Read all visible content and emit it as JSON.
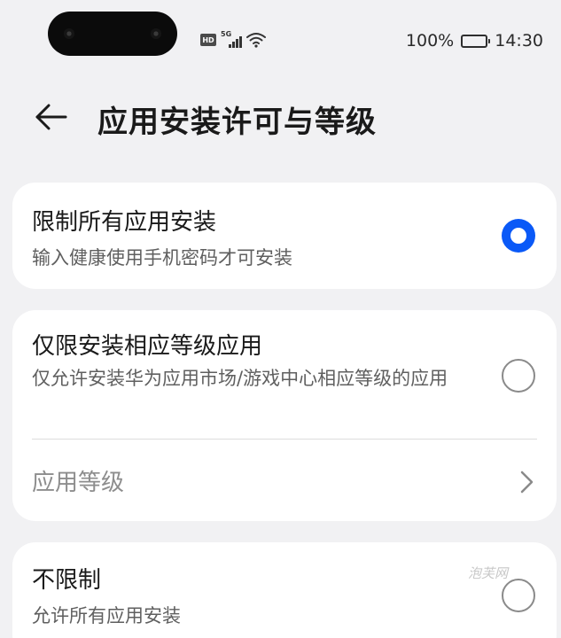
{
  "status_bar": {
    "hd_label": "HD",
    "network_label": "5G",
    "battery_percent_text": "100%",
    "battery_level": 1.0,
    "time": "14:30",
    "icons": [
      "hd-icon",
      "signal-icon",
      "wifi-icon",
      "battery-icon"
    ]
  },
  "header": {
    "back_icon": "back-arrow-icon",
    "title": "应用安装许可与等级"
  },
  "options": [
    {
      "title": "限制所有应用安装",
      "description": "输入健康使用手机密码才可安装",
      "selected": true
    },
    {
      "title": "仅限安装相应等级应用",
      "description": "仅允许安装华为应用市场/游戏中心相应等级的应用",
      "selected": false,
      "sub_item": {
        "label": "应用等级",
        "icon": "chevron-right-icon"
      }
    },
    {
      "title": "不限制",
      "description": "允许所有应用安装",
      "selected": false
    }
  ],
  "watermark": "泡芙网",
  "colors": {
    "background": "#f1f1f3",
    "card": "#ffffff",
    "accent": "#0a59f7",
    "title_text": "#1a1a1a",
    "secondary_text": "#5f5f5f",
    "disabled_text": "#8d8d8d"
  }
}
